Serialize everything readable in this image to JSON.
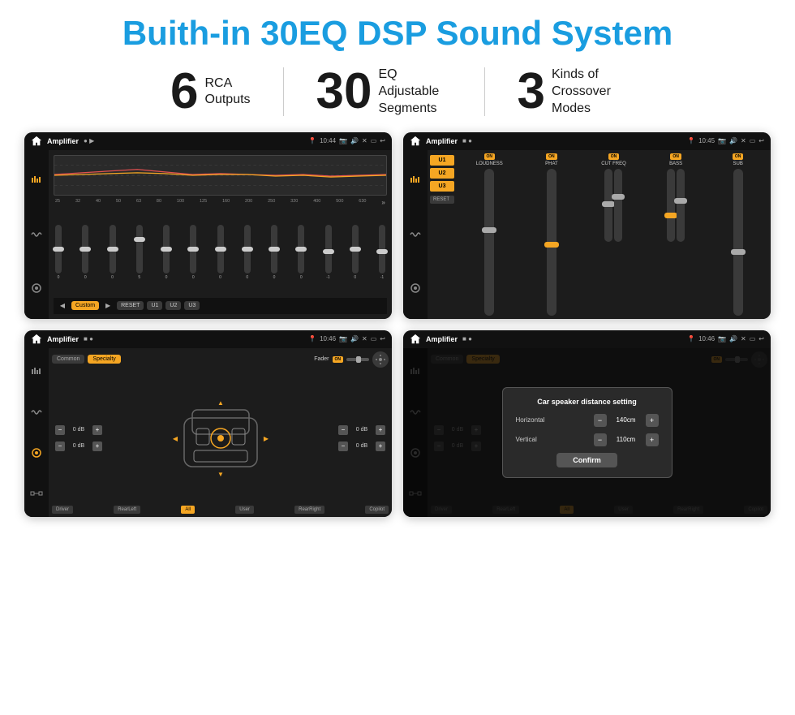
{
  "header": {
    "main_title": "Buith-in 30EQ DSP Sound System"
  },
  "stats": [
    {
      "number": "6",
      "label": "RCA\nOutputs"
    },
    {
      "number": "30",
      "label": "EQ Adjustable\nSegments"
    },
    {
      "number": "3",
      "label": "Kinds of\nCrossover Modes"
    }
  ],
  "screen1": {
    "status_title": "Amplifier",
    "status_time": "10:44",
    "freqs": [
      "25",
      "32",
      "40",
      "50",
      "63",
      "80",
      "100",
      "125",
      "160",
      "200",
      "250",
      "320",
      "400",
      "500",
      "630"
    ],
    "slider_values": [
      "0",
      "0",
      "0",
      "5",
      "0",
      "0",
      "0",
      "0",
      "0",
      "0",
      "-1",
      "0",
      "-1"
    ],
    "buttons": [
      "Custom",
      "RESET",
      "U1",
      "U2",
      "U3"
    ]
  },
  "screen2": {
    "status_title": "Amplifier",
    "status_time": "10:45",
    "presets": [
      "U1",
      "U2",
      "U3"
    ],
    "modules": [
      {
        "name": "LOUDNESS",
        "on": true
      },
      {
        "name": "PHAT",
        "on": true
      },
      {
        "name": "CUT FREQ",
        "on": true
      },
      {
        "name": "BASS",
        "on": true
      },
      {
        "name": "SUB",
        "on": true
      }
    ],
    "reset_label": "RESET"
  },
  "screen3": {
    "status_title": "Amplifier",
    "status_time": "10:46",
    "tabs": [
      "Common",
      "Specialty"
    ],
    "fader_label": "Fader",
    "on_label": "ON",
    "db_values": [
      "0 dB",
      "0 dB",
      "0 dB",
      "0 dB"
    ],
    "bottom_buttons": [
      "Driver",
      "RearLeft",
      "All",
      "User",
      "RearRight",
      "Copilot"
    ]
  },
  "screen4": {
    "status_title": "Amplifier",
    "status_time": "10:46",
    "tabs": [
      "Common",
      "Specialty"
    ],
    "on_label": "ON",
    "dialog": {
      "title": "Car speaker distance setting",
      "horizontal_label": "Horizontal",
      "horizontal_value": "140cm",
      "vertical_label": "Vertical",
      "vertical_value": "110cm",
      "confirm_label": "Confirm",
      "minus_label": "−",
      "plus_label": "+"
    },
    "db_values": [
      "0 dB",
      "0 dB"
    ],
    "bottom_buttons": [
      "Driver",
      "RearLeft",
      "All",
      "User",
      "RearRight",
      "Copilot"
    ]
  },
  "icons": {
    "home": "⌂",
    "back": "↩",
    "location": "📍",
    "camera": "📷",
    "volume": "🔊",
    "power": "✕",
    "minimize": "▭",
    "eq_icon": "≡",
    "wave_icon": "〜",
    "speaker_icon": "◈",
    "settings_icon": "⚙",
    "expand": "»"
  },
  "colors": {
    "accent": "#f5a623",
    "bg_dark": "#1c1c1c",
    "bg_darker": "#111111",
    "text_light": "#cccccc",
    "text_dim": "#888888",
    "title_blue": "#1a9de0"
  }
}
